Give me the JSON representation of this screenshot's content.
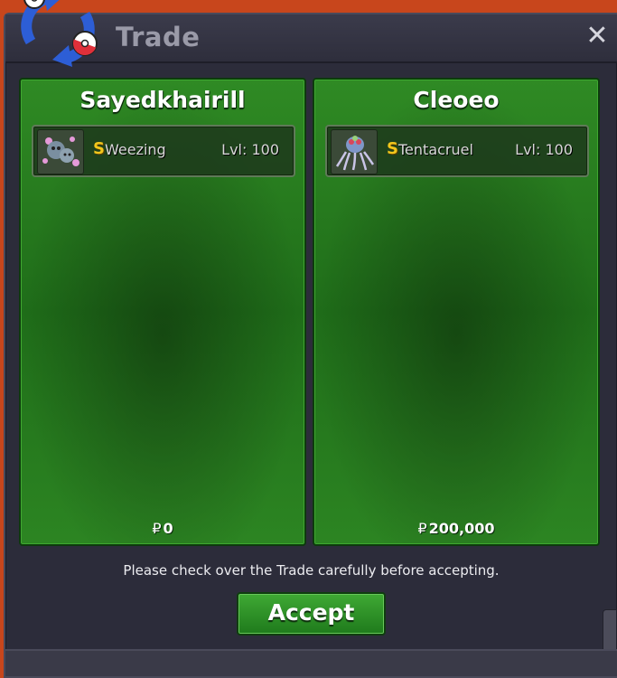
{
  "window": {
    "title": "Trade",
    "close_label": "✕"
  },
  "left": {
    "player": "Sayedkhairill",
    "slot": {
      "shiny_mark": "S",
      "pokemon": "Weezing",
      "level": "Lvl: 100",
      "icon": "weezing-sprite"
    },
    "money_symbol": "₽",
    "money": "0"
  },
  "right": {
    "player": "Cleoeo",
    "slot": {
      "shiny_mark": "S",
      "pokemon": "Tentacruel",
      "level": "Lvl: 100",
      "icon": "tentacruel-sprite"
    },
    "money_symbol": "₽",
    "money": "200,000"
  },
  "notice": "Please check over the Trade carefully before accepting.",
  "accept_label": "Accept",
  "colors": {
    "panel_green": "#2a7f22",
    "shiny_gold": "#f2c61c",
    "window_dark": "#2c2c3a"
  }
}
